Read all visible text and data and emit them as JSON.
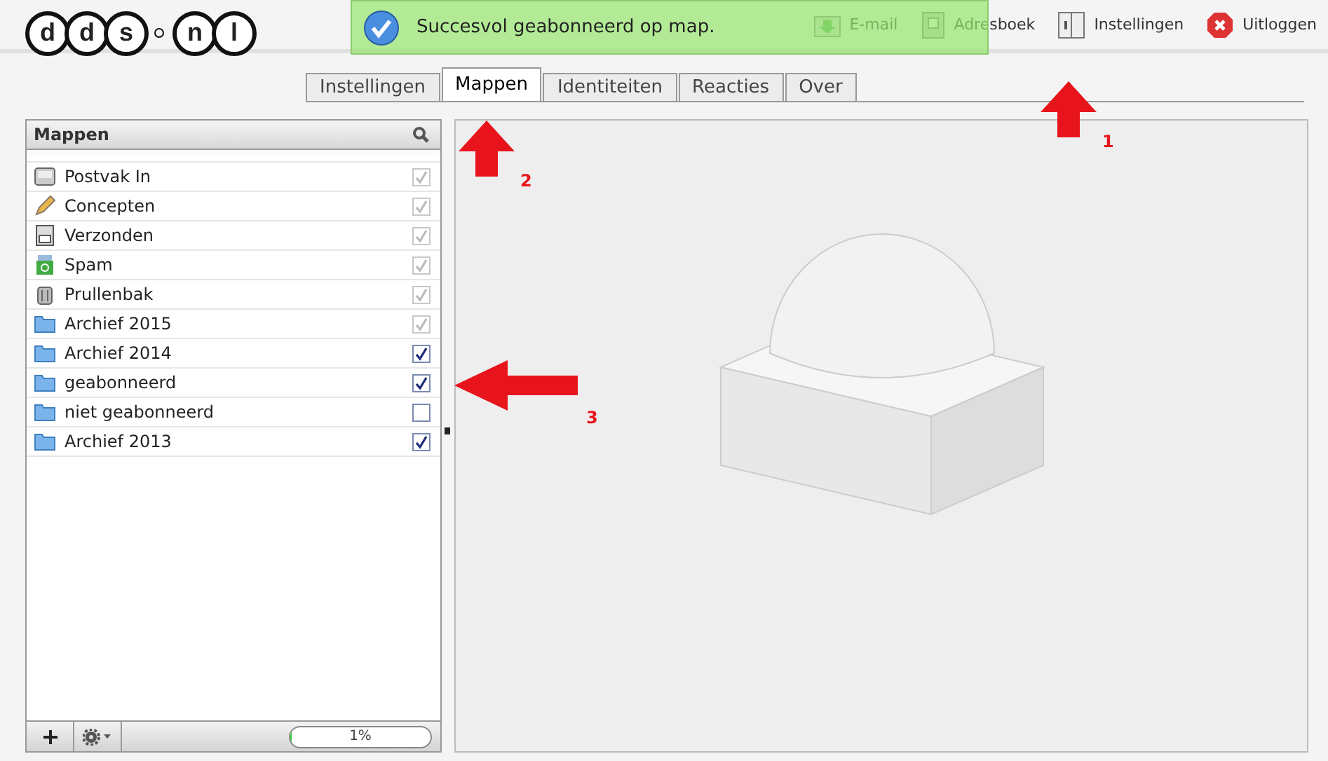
{
  "logo": {
    "groups": [
      [
        "d",
        "d",
        "s"
      ],
      [
        "n",
        "l"
      ]
    ]
  },
  "notification": {
    "text": "Succesvol geabonneerd op map."
  },
  "toolbar": [
    {
      "kind": "mail",
      "label": "E-mail"
    },
    {
      "kind": "addressbook",
      "label": "Adresboek"
    },
    {
      "kind": "settings",
      "label": "Instellingen"
    },
    {
      "kind": "logout",
      "label": "Uitloggen"
    }
  ],
  "tabs": [
    {
      "label": "Instellingen",
      "selected": false
    },
    {
      "label": "Mappen",
      "selected": true
    },
    {
      "label": "Identiteiten",
      "selected": false
    },
    {
      "label": "Reacties",
      "selected": false
    },
    {
      "label": "Over",
      "selected": false
    }
  ],
  "folders_panel": {
    "title": "Mappen",
    "folders": [
      {
        "kind": "inbox",
        "name": "Postvak In",
        "checked": true,
        "disabled": true
      },
      {
        "kind": "drafts",
        "name": "Concepten",
        "checked": true,
        "disabled": true
      },
      {
        "kind": "sent",
        "name": "Verzonden",
        "checked": true,
        "disabled": true
      },
      {
        "kind": "spam",
        "name": "Spam",
        "checked": true,
        "disabled": true
      },
      {
        "kind": "trash",
        "name": "Prullenbak",
        "checked": true,
        "disabled": true
      },
      {
        "kind": "folder",
        "name": "Archief 2015",
        "checked": true,
        "disabled": true
      },
      {
        "kind": "folder",
        "name": "Archief 2014",
        "checked": true,
        "disabled": false
      },
      {
        "kind": "folder",
        "name": "geabonneerd",
        "checked": true,
        "disabled": false
      },
      {
        "kind": "folder",
        "name": "niet geabonneerd",
        "checked": false,
        "disabled": false
      },
      {
        "kind": "folder",
        "name": "Archief 2013",
        "checked": true,
        "disabled": false
      }
    ],
    "quota": {
      "level": 0.01,
      "text": "1%"
    }
  },
  "annotations": [
    {
      "kind": "up",
      "number": "1"
    },
    {
      "kind": "up",
      "number": "2"
    },
    {
      "kind": "left",
      "number": "3"
    }
  ]
}
